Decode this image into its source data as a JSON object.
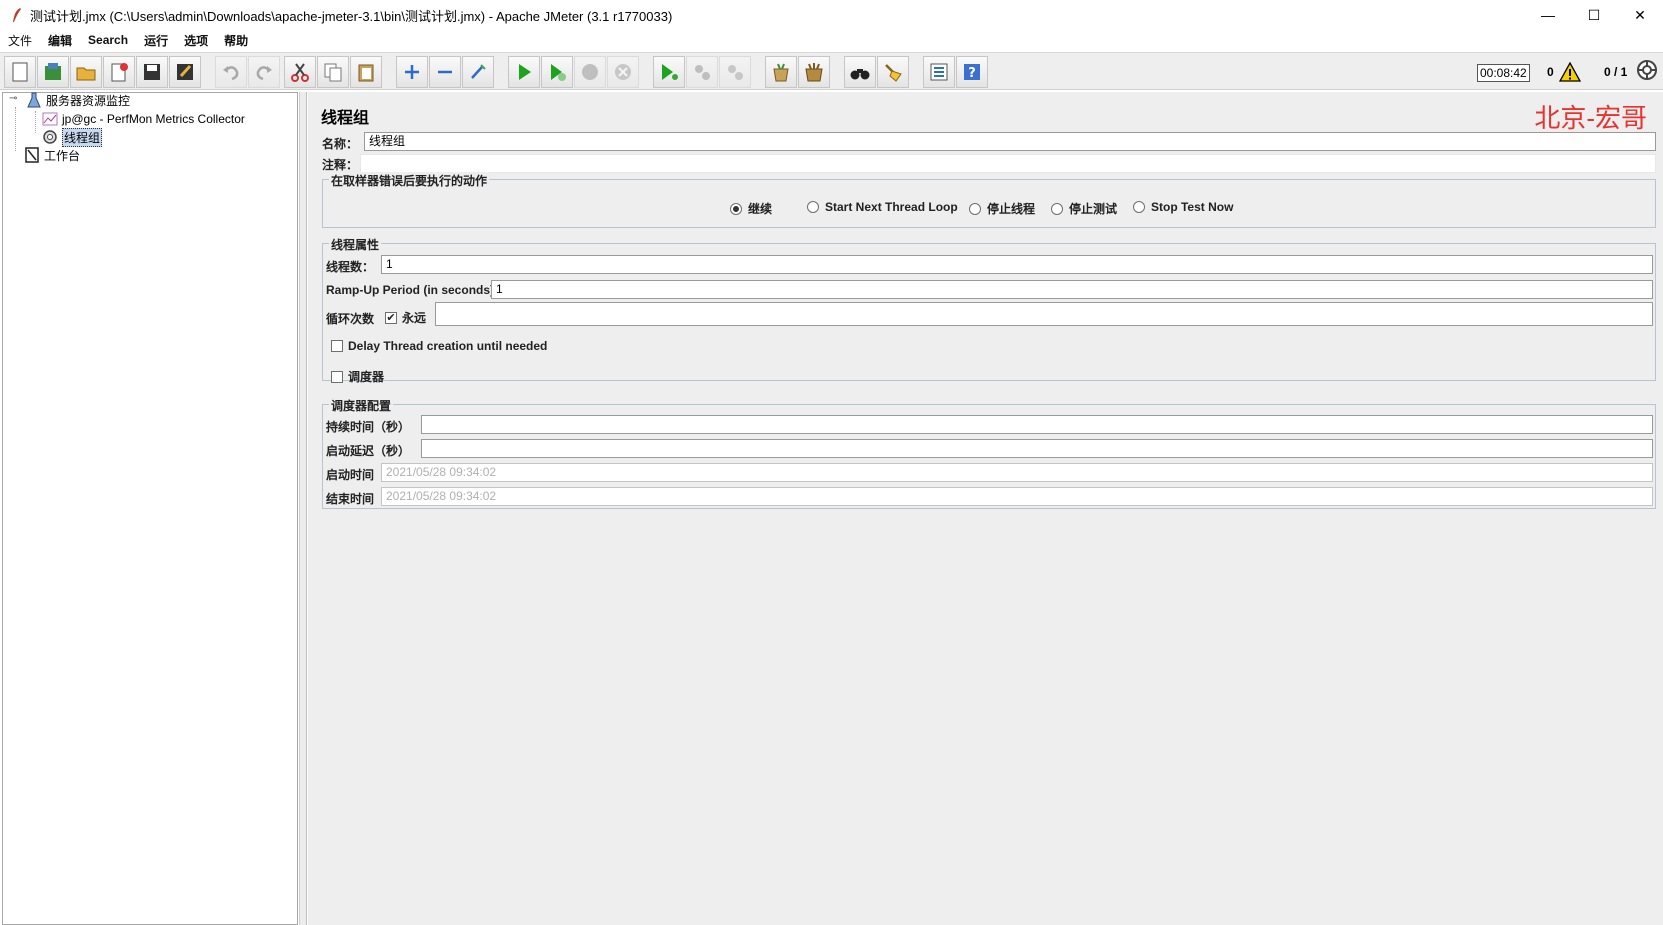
{
  "window": {
    "title": "测试计划.jmx (C:\\Users\\admin\\Downloads\\apache-jmeter-3.1\\bin\\测试计划.jmx) - Apache JMeter (3.1 r1770033)",
    "minimize": "—",
    "maximize": "☐",
    "close": "✕"
  },
  "menu": [
    "文件",
    "编辑",
    "Search",
    "运行",
    "选项",
    "帮助"
  ],
  "status": {
    "timer": "00:08:42",
    "error_count": "0",
    "threads": "0 / 1"
  },
  "tree": {
    "root": "服务器资源监控",
    "perfmon": "jp@gc - PerfMon Metrics Collector",
    "thread_group": "线程组",
    "workbench": "工作台"
  },
  "panel": {
    "title": "线程组",
    "watermark": "北京-宏哥",
    "name_label": "名称：",
    "name_value": "线程组",
    "comment_label": "注释：",
    "comment_value": "",
    "error_action": {
      "title": "在取样器错误后要执行的动作",
      "options": [
        "继续",
        "Start Next Thread Loop",
        "停止线程",
        "停止测试",
        "Stop Test Now"
      ],
      "selected": "继续"
    },
    "thread_props": {
      "title": "线程属性",
      "threads_label": "线程数：",
      "threads_value": "1",
      "rampup_label": "Ramp-Up Period (in seconds):",
      "rampup_value": "1",
      "loop_label": "循环次数",
      "forever_label": "永远",
      "forever_checked": true,
      "loop_value": "",
      "delay_label": "Delay Thread creation until needed",
      "delay_checked": false,
      "scheduler_label": "调度器",
      "scheduler_checked": false
    },
    "scheduler_config": {
      "title": "调度器配置",
      "duration_label": "持续时间（秒）",
      "duration_value": "",
      "delay_label": "启动延迟（秒）",
      "delay_value": "",
      "start_label": "启动时间",
      "start_value": "2021/05/28 09:34:02",
      "end_label": "结束时间",
      "end_value": "2021/05/28 09:34:02"
    }
  }
}
